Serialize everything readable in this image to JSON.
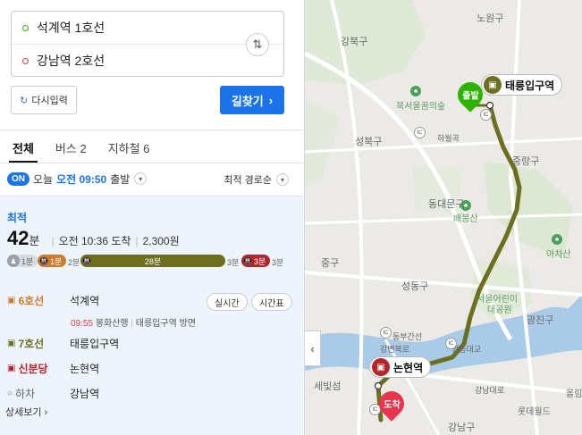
{
  "search": {
    "origin": "석계역 1호선",
    "destination": "강남역 2호선",
    "swap_icon": "swap-icon",
    "reset_label": "다시입력",
    "submit_label": "길찾기"
  },
  "tabs": [
    {
      "label": "전체",
      "active": true
    },
    {
      "label": "버스 2",
      "active": false
    },
    {
      "label": "지하철 6",
      "active": false
    }
  ],
  "depart": {
    "on_badge": "ON",
    "today": "오늘",
    "time": "오전 09:50",
    "suffix": "출발",
    "sort_label": "최적 경로순"
  },
  "result": {
    "badge": "최적",
    "duration_value": "42",
    "duration_unit": "분",
    "arrival": "오전 10:36 도착",
    "fare": "2,300원",
    "segments": {
      "walk1": "1분",
      "bus6_wait": "1분",
      "walk2": "2분",
      "line7": "28분",
      "walk3": "3분",
      "sinbun": "3분",
      "walk4": "3분"
    },
    "legs": [
      {
        "line": "6호선",
        "station": "석계역",
        "color": "#cd7c2f"
      },
      {
        "line": "7호선",
        "station": "태릉입구역",
        "color": "#6b6f1f"
      },
      {
        "line": "신분당",
        "station": "논현역",
        "color": "#b5232b"
      },
      {
        "line": "하차",
        "station": "강남역",
        "color": "#666666"
      }
    ],
    "realtime_label": "실시간",
    "timetable_label": "시간표",
    "sub_time": "09:55",
    "sub_text": "봉화산행",
    "sub_dir": "태릉입구역 방면",
    "detail_label": "상세보기"
  },
  "map": {
    "labels": {
      "nowon": "노원구",
      "gangbuk": "강북구",
      "bukseoul": "북서울꿈의숲",
      "seongbuk": "성북구",
      "jungnang": "중랑구",
      "dongdaemun": "동대문구",
      "baebongsan": "배봉산",
      "achasan": "아차산",
      "junggu": "중구",
      "seongdong": "성동구",
      "childrens_park": "서울어린이",
      "grand_park": "대공원",
      "gwangjin": "광진구",
      "sebitseom": "세빛섬",
      "gangnam": "강남구",
      "lotteworld": "롯데월드",
      "olympic": "올림",
      "hawolgok": "하월곡",
      "dongbu": "동부간선",
      "gangbyeon": "강변북로",
      "yeongdong": "영동대교",
      "gyeongbu": "강남대로"
    },
    "station_taereung": "태릉입구역",
    "station_nonhyeon": "논현역",
    "start_pin": "출발",
    "end_pin": "도착",
    "sinbun_partial": "석계역",
    "route_color": "#6b6f1f",
    "origin_color": "#2db400",
    "dest_color": "#e8344d"
  }
}
